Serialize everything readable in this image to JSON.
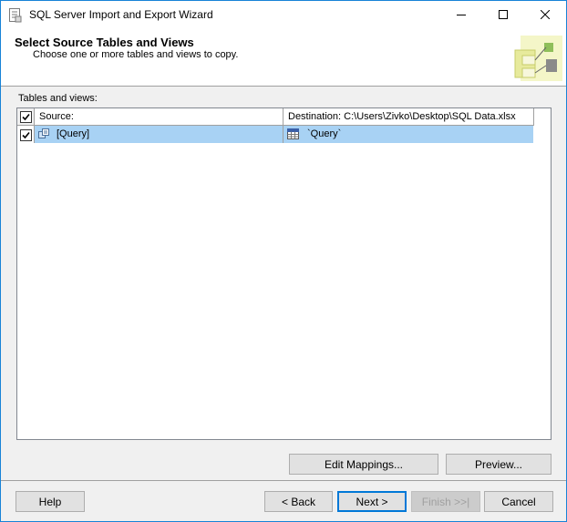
{
  "window": {
    "title": "SQL Server Import and Export Wizard",
    "controls": {
      "minimize": "minimize-icon",
      "maximize": "maximize-icon",
      "close": "close-icon"
    }
  },
  "header": {
    "title": "Select Source Tables and Views",
    "subtitle": "Choose one or more tables and views to copy."
  },
  "tables": {
    "label": "Tables and views:",
    "columns": {
      "check_all": true,
      "source": "Source:",
      "destination": "Destination: C:\\Users\\Zivko\\Desktop\\SQL Data.xlsx"
    },
    "rows": [
      {
        "checked": true,
        "source": "[Query]",
        "destination": "`Query`",
        "selected": true
      }
    ]
  },
  "buttons": {
    "edit_mappings": "Edit Mappings...",
    "preview": "Preview...",
    "help": "Help",
    "back": "< Back",
    "next": "Next >",
    "finish": "Finish >>|",
    "cancel": "Cancel"
  },
  "colors": {
    "selection": "#a8d2f4",
    "window_border": "#1883d7",
    "default_button_border": "#0078d7"
  }
}
